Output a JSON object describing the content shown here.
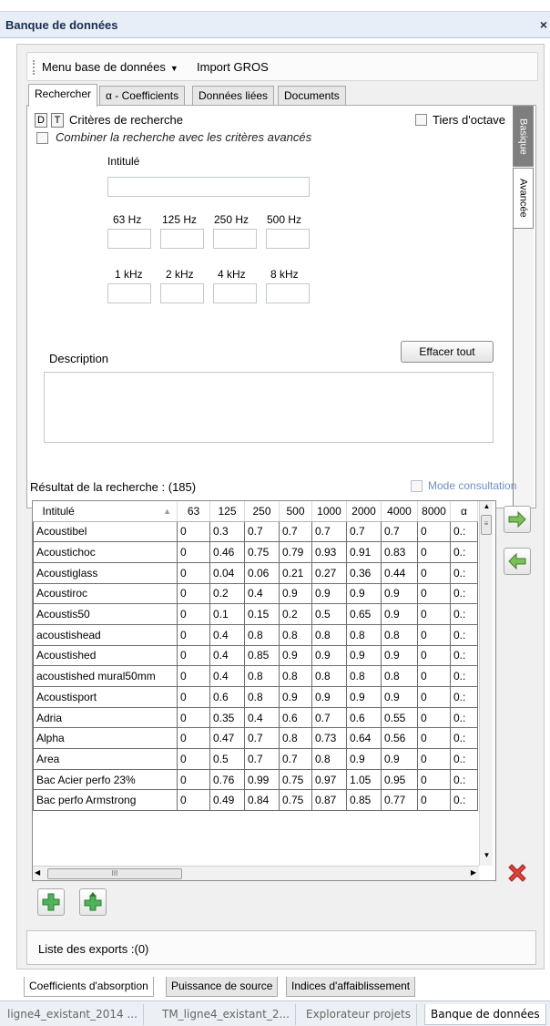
{
  "window": {
    "title": "Banque de données",
    "close_glyph": "×"
  },
  "menubar": {
    "items": [
      "Menu base de données",
      "Import GROS"
    ]
  },
  "tabs": [
    "Rechercher",
    "α - Coefficients",
    "Données liées",
    "Documents"
  ],
  "search": {
    "d_button": "D",
    "t_button": "T",
    "criteria_label": "Critères de recherche",
    "combine_label": "Combiner la recherche avec les critères avancés",
    "tiers_label": "Tiers d'octave",
    "intitule_label": "Intitulé",
    "freq_row1": [
      "63 Hz",
      "125 Hz",
      "250 Hz",
      "500 Hz"
    ],
    "freq_row2": [
      "1 kHz",
      "2 kHz",
      "4 kHz",
      "8 kHz"
    ],
    "description_label": "Description",
    "clear_button": "Effacer tout",
    "side_tabs": [
      "Basique",
      "Avancée"
    ]
  },
  "results": {
    "label": "Résultat de la recherche : (185)",
    "mode_label": "Mode consultation",
    "columns": [
      "Intitulé",
      "63",
      "125",
      "250",
      "500",
      "1000",
      "2000",
      "4000",
      "8000",
      "α"
    ],
    "rows": [
      [
        "Acoustibel",
        "0",
        "0.3",
        "0.7",
        "0.7",
        "0.7",
        "0.7",
        "0.7",
        "0",
        "0.:"
      ],
      [
        "Acoustichoc",
        "0",
        "0.46",
        "0.75",
        "0.79",
        "0.93",
        "0.91",
        "0.83",
        "0",
        "0.:"
      ],
      [
        "Acoustiglass",
        "0",
        "0.04",
        "0.06",
        "0.21",
        "0.27",
        "0.36",
        "0.44",
        "0",
        "0.:"
      ],
      [
        "Acoustiroc",
        "0",
        "0.2",
        "0.4",
        "0.9",
        "0.9",
        "0.9",
        "0.9",
        "0",
        "0.:"
      ],
      [
        "Acoustis50",
        "0",
        "0.1",
        "0.15",
        "0.2",
        "0.5",
        "0.65",
        "0.9",
        "0",
        "0.:"
      ],
      [
        "acoustishead",
        "0",
        "0.4",
        "0.8",
        "0.8",
        "0.8",
        "0.8",
        "0.8",
        "0",
        "0.:"
      ],
      [
        "Acoustished",
        "0",
        "0.4",
        "0.85",
        "0.9",
        "0.9",
        "0.9",
        "0.9",
        "0",
        "0.:"
      ],
      [
        "acoustished mural50mm",
        "0",
        "0.4",
        "0.8",
        "0.8",
        "0.8",
        "0.8",
        "0.8",
        "0",
        "0.:"
      ],
      [
        "Acoustisport",
        "0",
        "0.6",
        "0.8",
        "0.9",
        "0.9",
        "0.9",
        "0.9",
        "0",
        "0.:"
      ],
      [
        "Adria",
        "0",
        "0.35",
        "0.4",
        "0.6",
        "0.7",
        "0.6",
        "0.55",
        "0",
        "0.:"
      ],
      [
        "Alpha",
        "0",
        "0.47",
        "0.7",
        "0.8",
        "0.73",
        "0.64",
        "0.56",
        "0",
        "0.:"
      ],
      [
        "Area",
        "0",
        "0.5",
        "0.7",
        "0.7",
        "0.8",
        "0.9",
        "0.9",
        "0",
        "0.:"
      ],
      [
        "Bac Acier perfo 23%",
        "0",
        "0.76",
        "0.99",
        "0.75",
        "0.97",
        "1.05",
        "0.95",
        "0",
        "0.:"
      ],
      [
        "Bac perfo Armstrong",
        "0",
        "0.49",
        "0.84",
        "0.75",
        "0.87",
        "0.85",
        "0.77",
        "0",
        "0.:"
      ]
    ]
  },
  "exports": {
    "label": "Liste des exports :(0)"
  },
  "bottom_tabs": [
    "Coefficients d'absorption",
    "Puissance de source",
    "Indices d'affaiblissement"
  ],
  "doc_tabs": [
    "ligne4_existant_2014 ...",
    "TM_ligne4_existant_2...",
    "Explorateur projets",
    "Banque de données"
  ],
  "colors": {
    "accent": "#6f8fbf",
    "green_arrow": "#4caf50",
    "delete_red": "#d9342b"
  },
  "icons": [
    "export-right-arrow-icon",
    "import-left-arrow-icon",
    "delete-x-icon",
    "add-plus-icon",
    "add-plus-up-icon"
  ]
}
